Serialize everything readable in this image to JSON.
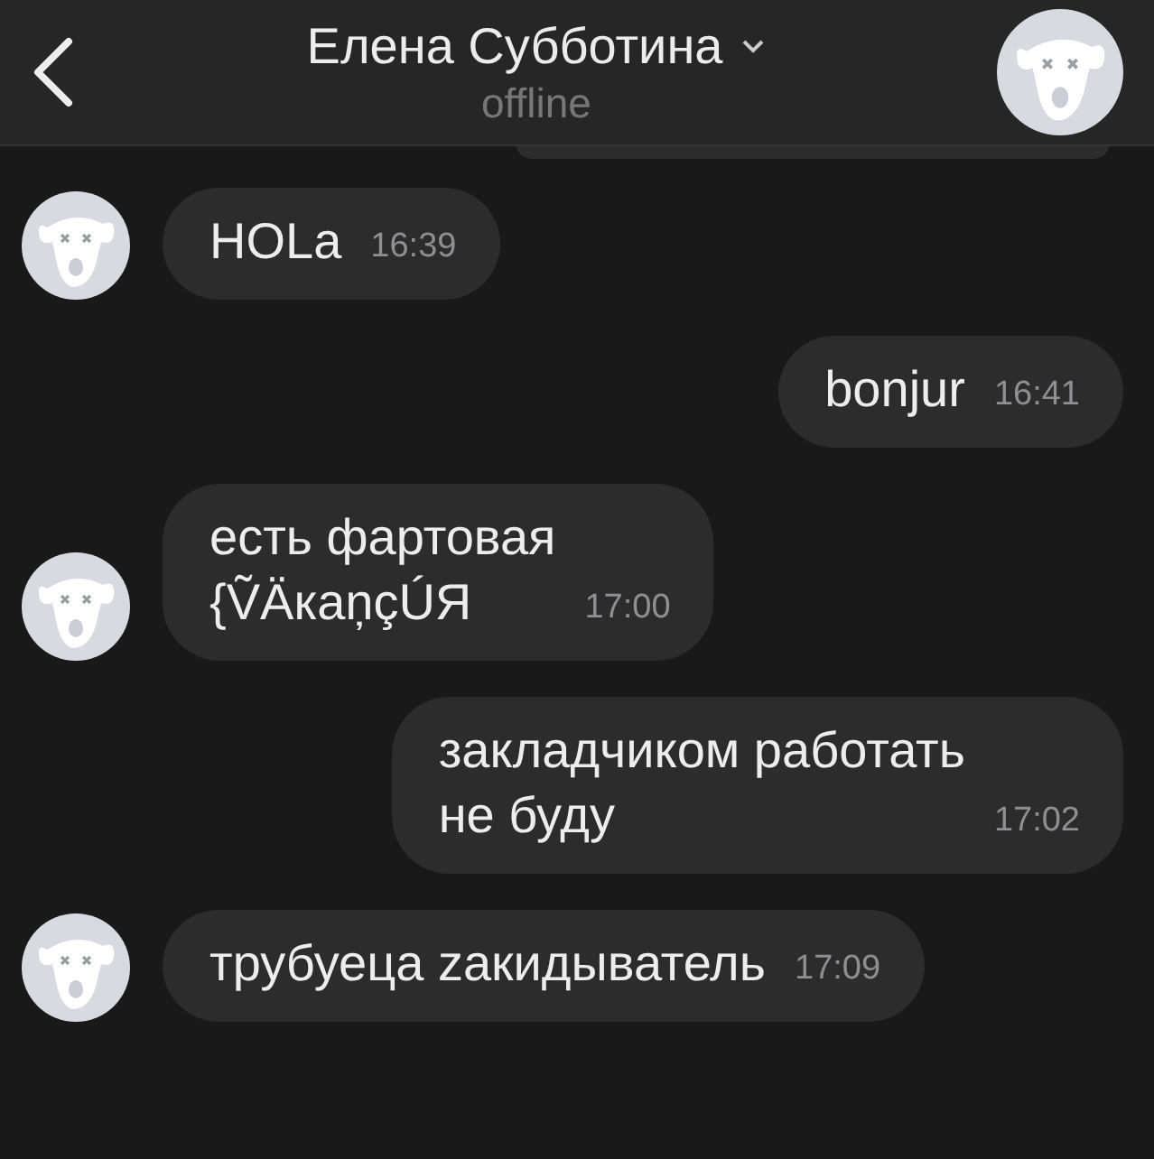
{
  "header": {
    "title": "Елена Субботина",
    "status": "offline"
  },
  "messages": [
    {
      "kind": "incoming",
      "text": "HOLa",
      "time": "16:39"
    },
    {
      "kind": "outgoing",
      "text": "bonjur",
      "time": "16:41"
    },
    {
      "kind": "incoming",
      "text": "есть фартовая\n{ṼÄкаņçÚЯ",
      "time": "17:00"
    },
    {
      "kind": "outgoing",
      "text": "закладчиком работать\nне буду",
      "time": "17:02"
    },
    {
      "kind": "incoming",
      "text": "трубуеца zaкидыватель",
      "time": "17:09"
    }
  ]
}
